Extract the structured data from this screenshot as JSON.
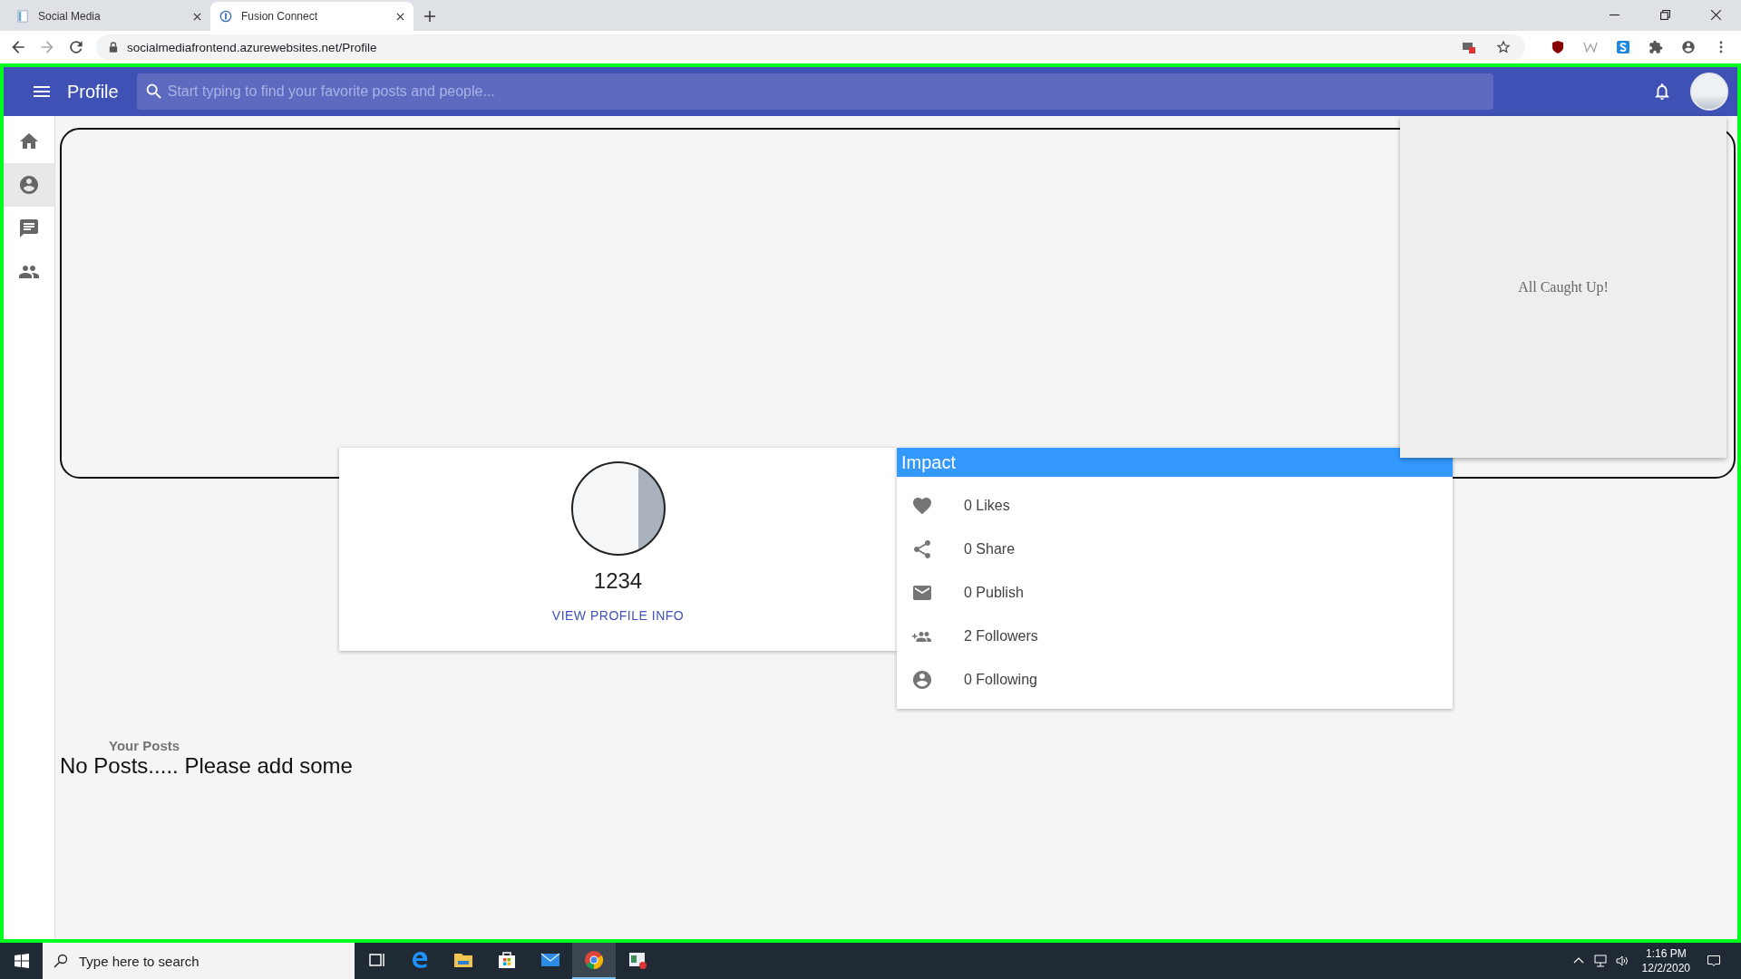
{
  "browser": {
    "tabs": [
      {
        "title": "Social Media",
        "selected": false
      },
      {
        "title": "Fusion Connect",
        "selected": true
      }
    ],
    "url": "socialmediafrontend.azurewebsites.net/Profile"
  },
  "app_bar": {
    "title": "Profile",
    "search": {
      "placeholder": "Start typing to find your favorite posts and people..."
    }
  },
  "sidebar": {
    "items": [
      {
        "kind": "home",
        "selected": false
      },
      {
        "kind": "account",
        "selected": true
      },
      {
        "kind": "chat",
        "selected": false
      },
      {
        "kind": "people",
        "selected": false
      }
    ]
  },
  "notifications": {
    "message": "All Caught Up!"
  },
  "profile_card": {
    "name": "1234",
    "link": "VIEW PROFILE INFO"
  },
  "impact": {
    "title": "Impact",
    "items": [
      {
        "kind": "likes",
        "label": "0 Likes"
      },
      {
        "kind": "share",
        "label": "0 Share"
      },
      {
        "kind": "publish",
        "label": "0 Publish"
      },
      {
        "kind": "followers",
        "label": "2 Followers"
      },
      {
        "kind": "following",
        "label": "0 Following"
      }
    ]
  },
  "posts": {
    "heading": "Your Posts",
    "empty": "No Posts..... Please add some"
  },
  "taskbar": {
    "search_placeholder": "Type here to search",
    "apps": [
      {
        "kind": "taskview",
        "active": false
      },
      {
        "kind": "edge",
        "active": false
      },
      {
        "kind": "explorer",
        "active": false
      },
      {
        "kind": "store",
        "active": false
      },
      {
        "kind": "mail",
        "active": false
      },
      {
        "kind": "chrome",
        "active": true
      },
      {
        "kind": "recorder",
        "active": false
      }
    ],
    "time": "1:16 PM",
    "date": "12/2/2020"
  }
}
